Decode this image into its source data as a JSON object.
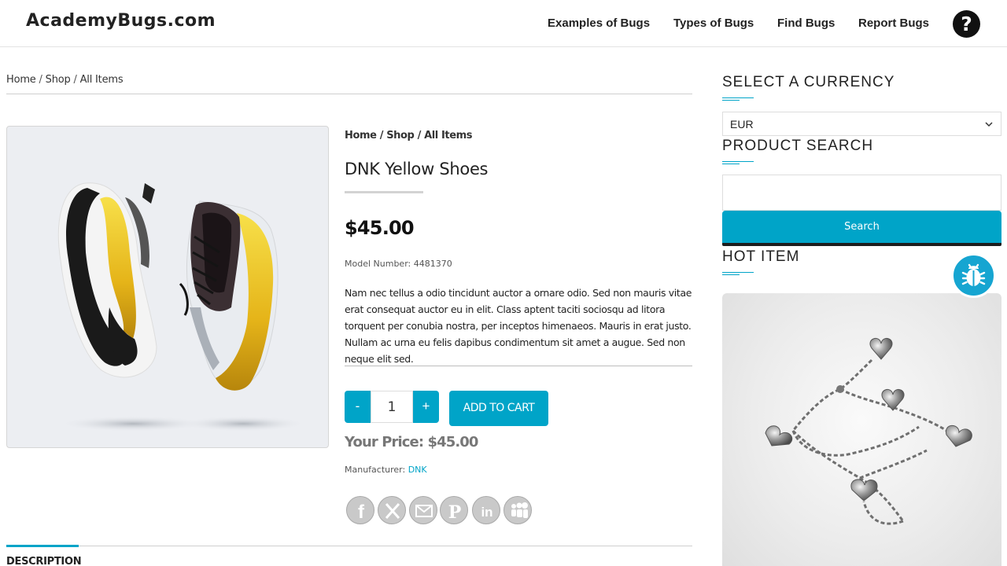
{
  "header": {
    "logo": "AcademyBugs.com",
    "nav": [
      "Examples of Bugs",
      "Types of Bugs",
      "Find Bugs",
      "Report Bugs"
    ],
    "help_icon": "question-circle-icon"
  },
  "breadcrumb": {
    "home": "Home",
    "shop": "Shop",
    "current": "All Items",
    "sep": " / "
  },
  "product": {
    "title": "DNK Yellow Shoes",
    "price": "$45.00",
    "model": "Model Number: 4481370",
    "description": "Nam nec tellus a odio tincidunt auctor a ornare odio. Sed non mauris vitae erat consequat auctor eu in elit. Class aptent taciti sociosqu ad litora torquent per conubia nostra, per inceptos himenaeos. Mauris in erat justo. Nullam ac urna eu felis dapibus condimentum sit amet a augue. Sed non neque elit sed.",
    "qty_minus": "-",
    "qty_plus": "+",
    "quantity": "1",
    "add_to_cart": "ADD TO CART",
    "your_price": "Your Price: $45.00",
    "manufacturer_label": "Manufacturer: ",
    "manufacturer": "DNK",
    "share_icons": [
      "facebook-icon",
      "x-icon",
      "email-icon",
      "pinterest-icon",
      "linkedin-icon",
      "myspace-icon"
    ]
  },
  "tabs": {
    "description": "DESCRIPTION"
  },
  "sidebar": {
    "currency_title": "SELECT A CURRENCY",
    "currency_value": "EUR",
    "search_title": "PRODUCT SEARCH",
    "search_placeholder": "",
    "search_button": "Search",
    "hot_title": "HOT ITEM"
  },
  "colors": {
    "accent": "#00a4c8",
    "bug_button": "#16a5d1"
  }
}
